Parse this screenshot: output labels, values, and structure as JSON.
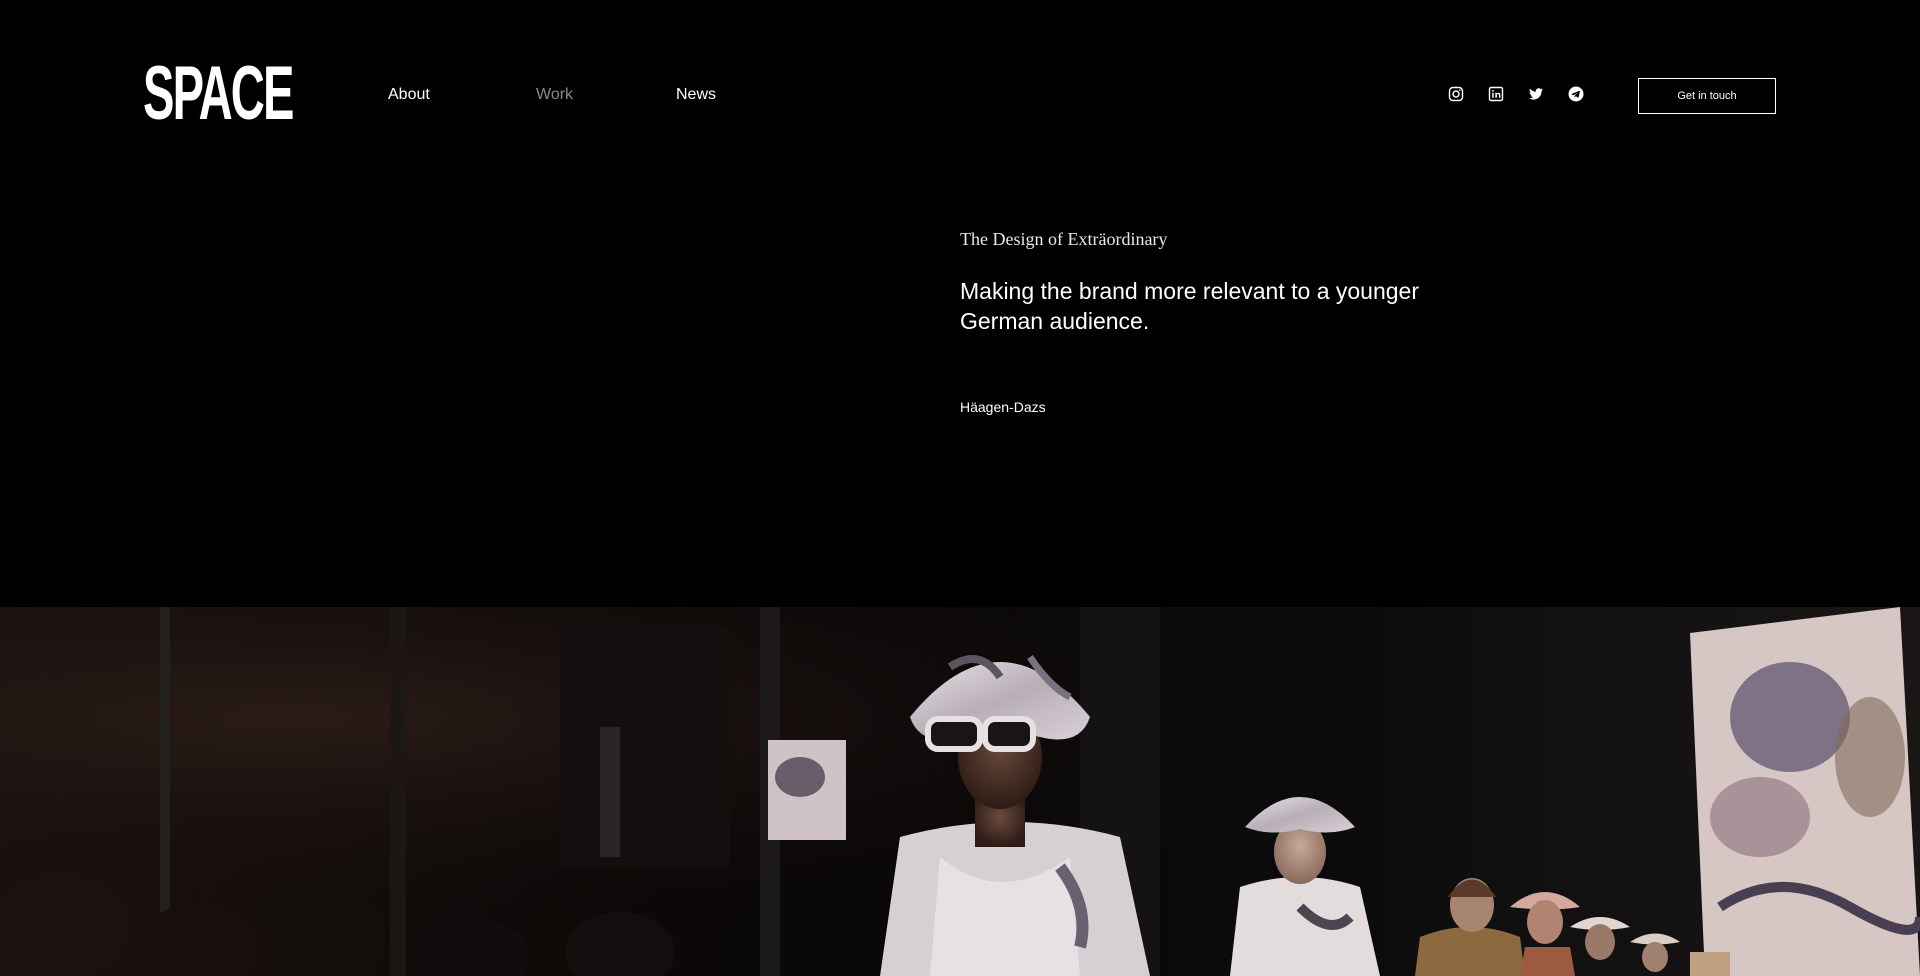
{
  "brand": {
    "logo_text": "SPACE"
  },
  "nav": {
    "items": [
      {
        "label": "About",
        "state": "default"
      },
      {
        "label": "Work",
        "state": "muted"
      },
      {
        "label": "News",
        "state": "default"
      }
    ]
  },
  "social": {
    "icons": [
      "instagram-icon",
      "linkedin-icon",
      "twitter-icon",
      "telegram-icon"
    ]
  },
  "cta": {
    "label": "Get in touch"
  },
  "intro": {
    "kicker": "The Design of Exträordinary",
    "headline": "Making the brand more relevant to a younger German audience.",
    "client": "Häagen-Dazs"
  },
  "colors": {
    "background": "#000000",
    "text": "#ffffff",
    "muted_nav": "#8a8a8a"
  }
}
